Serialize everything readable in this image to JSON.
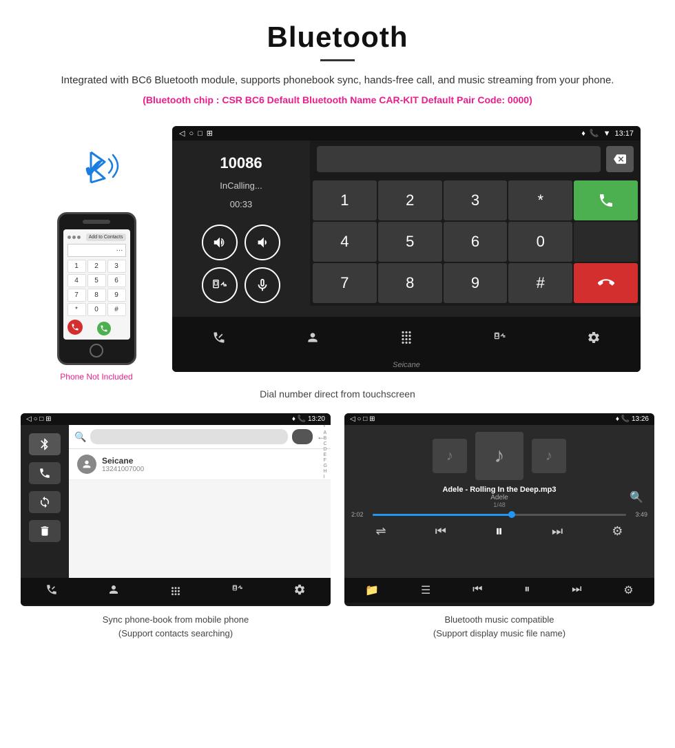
{
  "header": {
    "title": "Bluetooth",
    "description": "Integrated with BC6 Bluetooth module, supports phonebook sync, hands-free call, and music streaming from your phone.",
    "specs": "(Bluetooth chip : CSR BC6    Default Bluetooth Name CAR-KIT    Default Pair Code: 0000)"
  },
  "phone_label": "Phone Not Included",
  "dial_screen": {
    "status_bar": {
      "nav_back": "◁",
      "nav_home": "○",
      "nav_square": "□",
      "nav_menu": "⊞",
      "time": "13:17",
      "icons": "♦ 📞 ▼"
    },
    "number": "10086",
    "status": "InCalling...",
    "timer": "00:33",
    "keys": [
      "1",
      "2",
      "3",
      "*",
      "4",
      "5",
      "6",
      "0",
      "7",
      "8",
      "9",
      "#"
    ],
    "call_green": "📞",
    "call_red": "📞",
    "bottom_icons": [
      "📞",
      "👤",
      "⊞",
      "📱",
      "⚙"
    ]
  },
  "dial_caption": "Dial number direct from touchscreen",
  "phonebook": {
    "status_bar": {
      "left": "◁  ○  □  ⊞",
      "right": "♦ 📞 13:20"
    },
    "contact_name": "Seicane",
    "contact_number": "13241007000",
    "alphabet": [
      "*",
      "A",
      "B",
      "C",
      "D",
      "E",
      "F",
      "G",
      "H",
      "I"
    ],
    "bottom_icons": [
      "📞",
      "👤",
      "⊞",
      "📱",
      "⚙"
    ]
  },
  "phonebook_caption_line1": "Sync phone-book from mobile phone",
  "phonebook_caption_line2": "(Support contacts searching)",
  "music": {
    "status_bar": {
      "left": "◁  ○  □  ⊞",
      "right": "♦ 📞 13:26"
    },
    "song_title": "Adele - Rolling In the Deep.mp3",
    "artist": "Adele",
    "track_count": "1/48",
    "time_current": "2:02",
    "time_total": "3:49",
    "bottom_icons": [
      "📁",
      "≡",
      "⏮",
      "⏸",
      "⏭",
      "⚙"
    ]
  },
  "music_caption_line1": "Bluetooth music compatible",
  "music_caption_line2": "(Support display music file name)"
}
